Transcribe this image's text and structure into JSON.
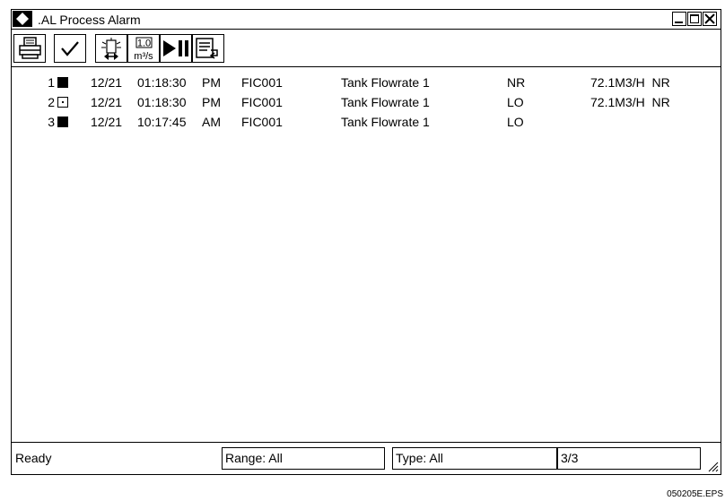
{
  "window": {
    "title": ".AL Process Alarm",
    "controls": [
      "minimize",
      "restore",
      "close"
    ]
  },
  "toolbar": {
    "buttons": [
      {
        "name": "print",
        "icon": "printer-icon"
      },
      {
        "name": "acknowledge",
        "icon": "check-icon"
      },
      {
        "name": "alarm-sound",
        "icon": "alarm-light-icon"
      },
      {
        "name": "units",
        "icon": "units-icon",
        "value_label": "1.0",
        "unit_label": "m³/s"
      },
      {
        "name": "play-pause",
        "icon": "play-pause-icon"
      },
      {
        "name": "export-list",
        "icon": "list-arrow-icon"
      }
    ]
  },
  "alarms": [
    {
      "num": "1",
      "state": "filled",
      "date": "12/21",
      "time": "01:18:30",
      "ampm": "PM",
      "tag": "FIC001",
      "description": "Tank Flowrate 1",
      "type": "NR",
      "value": "72.1M3/H  NR"
    },
    {
      "num": "2",
      "state": "ack",
      "date": "12/21",
      "time": "01:18:30",
      "ampm": "PM",
      "tag": "FIC001",
      "description": "Tank Flowrate 1",
      "type": "LO",
      "value": "72.1M3/H  NR"
    },
    {
      "num": "3",
      "state": "filled",
      "date": "12/21",
      "time": "10:17:45",
      "ampm": "AM",
      "tag": "FIC001",
      "description": "Tank Flowrate 1",
      "type": "LO",
      "value": ""
    }
  ],
  "status": {
    "ready": "Ready",
    "range": "Range: All",
    "type": "Type: All",
    "count": "3/3"
  },
  "footer": "050205E.EPS"
}
